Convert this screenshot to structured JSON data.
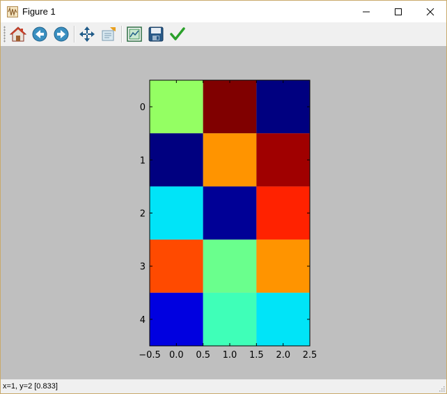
{
  "window": {
    "title": "Figure 1"
  },
  "toolbar": {
    "items": [
      {
        "name": "home",
        "icon": "home-icon"
      },
      {
        "name": "back",
        "icon": "back-arrow-icon"
      },
      {
        "name": "forward",
        "icon": "forward-arrow-icon"
      },
      {
        "name": "pan",
        "icon": "pan-icon"
      },
      {
        "name": "zoom",
        "icon": "zoom-rect-icon"
      },
      {
        "name": "subplots",
        "icon": "subplots-icon"
      },
      {
        "name": "save",
        "icon": "save-icon"
      },
      {
        "name": "edit",
        "icon": "checkmark-icon"
      }
    ]
  },
  "status": {
    "text": "x=1, y=2 [0.833]"
  },
  "chart_data": {
    "type": "heatmap",
    "colormap": "jet",
    "x_ticks": [
      "−0.5",
      "0.0",
      "0.5",
      "1.0",
      "1.5",
      "2.0",
      "2.5"
    ],
    "y_ticks": [
      "0",
      "1",
      "2",
      "3",
      "4"
    ],
    "xlim": [
      -0.5,
      2.5
    ],
    "ylim": [
      4.5,
      -0.5
    ],
    "values": [
      [
        0.55,
        0.95,
        0.1
      ],
      [
        0.1,
        0.75,
        0.9
      ],
      [
        0.35,
        0.1,
        0.85
      ],
      [
        0.82,
        0.55,
        0.75
      ],
      [
        0.15,
        0.45,
        0.35
      ]
    ],
    "cell_colors": [
      [
        "#94ff63",
        "#800000",
        "#000080"
      ],
      [
        "#000080",
        "#ff9400",
        "#a00000"
      ],
      [
        "#00e4f8",
        "#000096",
        "#ff2200"
      ],
      [
        "#ff4a00",
        "#6aff8d",
        "#ff9400"
      ],
      [
        "#0000e0",
        "#3fffb8",
        "#00e4f8"
      ]
    ]
  }
}
